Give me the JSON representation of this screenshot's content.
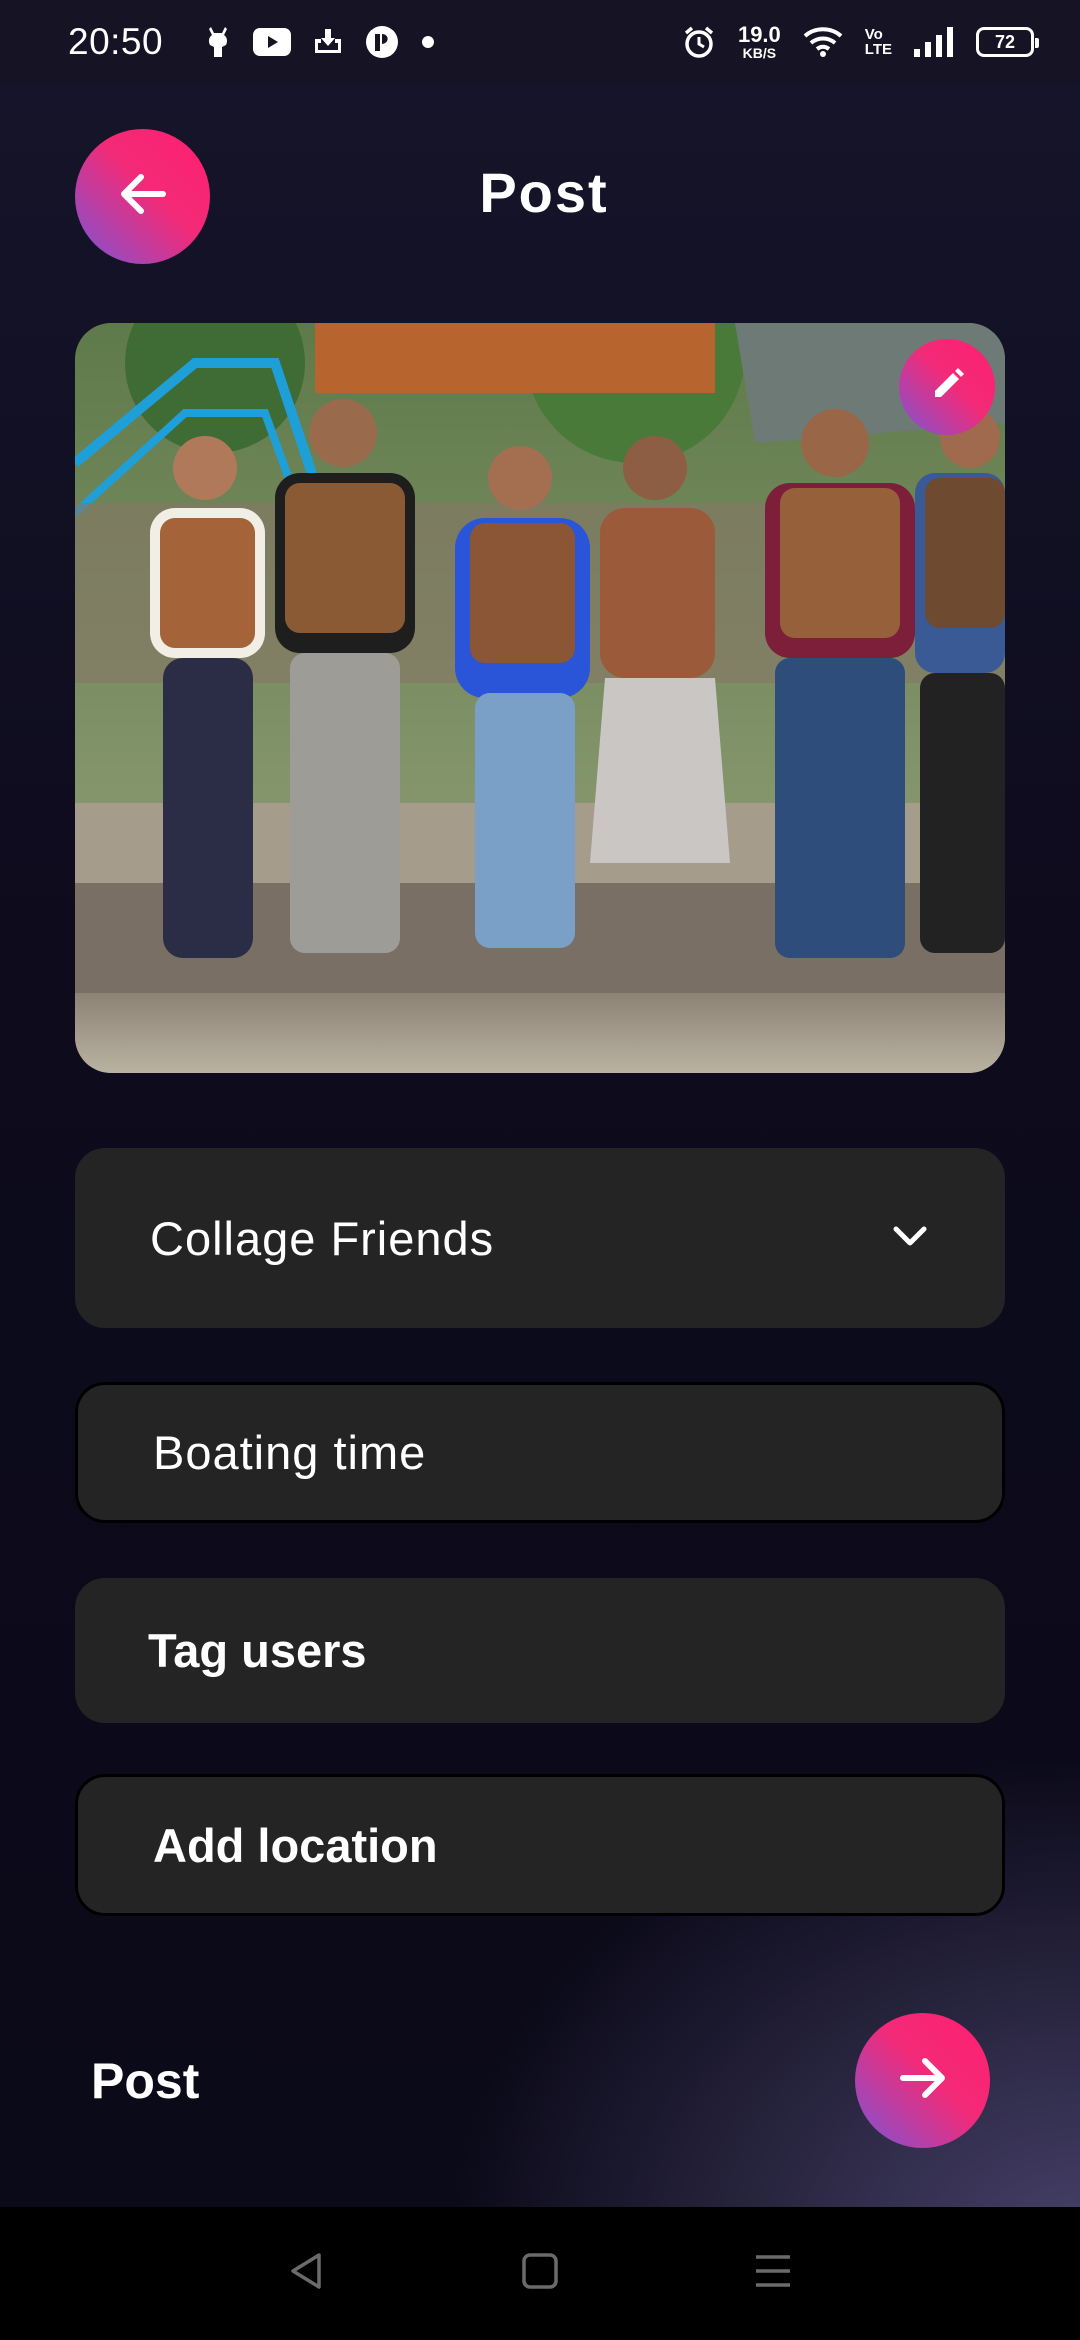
{
  "status_bar": {
    "time": "20:50",
    "net_speed_value": "19.0",
    "net_speed_unit": "KB/S",
    "volte_top": "Vo",
    "volte_bottom": "LTE",
    "battery": "72",
    "icons": [
      "notification-app-icon",
      "youtube-icon",
      "download-icon",
      "app-icon",
      "dot-icon",
      "alarm-icon",
      "wifi-icon",
      "signal-icon",
      "battery-icon"
    ]
  },
  "header": {
    "title": "Post",
    "back_icon": "arrow-left-icon"
  },
  "photo": {
    "edit_icon": "pencil-icon"
  },
  "form": {
    "group_dropdown": {
      "value": "Collage Friends",
      "icon": "chevron-down-icon"
    },
    "caption_input": {
      "value": "Boating time"
    },
    "tag_users_label": "Tag users",
    "add_location_label": "Add location"
  },
  "footer": {
    "post_label": "Post",
    "next_icon": "arrow-right-icon"
  },
  "nav_bar": {
    "icons": [
      "back-triangle-icon",
      "home-square-icon",
      "menu-lines-icon"
    ]
  },
  "colors": {
    "accent_pink": "#ff1f6f",
    "accent_purple": "#7b55d6",
    "field_bg": "#242424",
    "background": "#0d0b1a"
  }
}
